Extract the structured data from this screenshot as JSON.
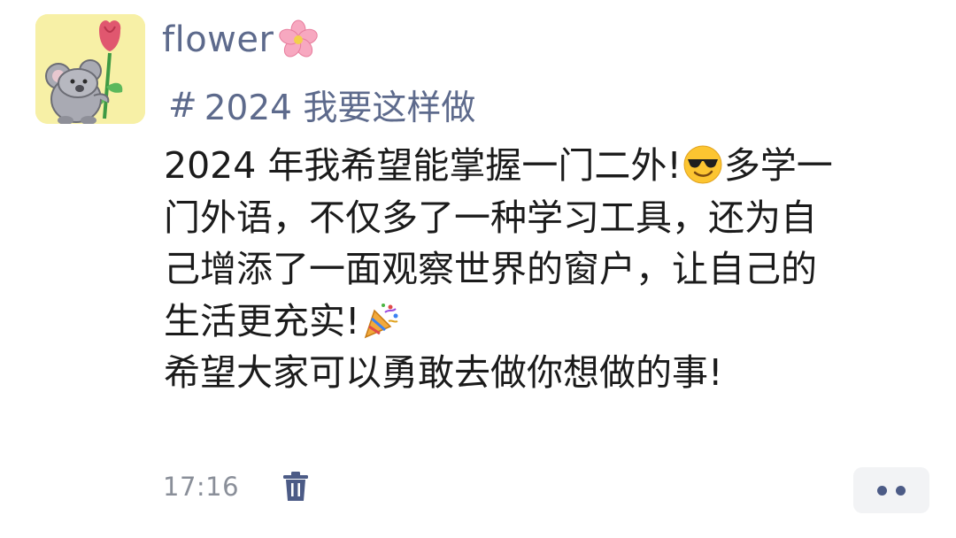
{
  "post": {
    "author": {
      "name": "flower",
      "name_emoji_icon": "cherry-blossom-icon",
      "avatar_icon": "koala-holding-rose-avatar"
    },
    "topic": {
      "hash": "#",
      "label": "2024 我要这样做"
    },
    "content_lines": [
      {
        "text_before": "2024 年我希望能掌握一门二外!",
        "emoji_icon": "sunglasses-face-icon",
        "text_after": "多学一"
      },
      {
        "text": "门外语，不仅多了一种学习工具，还为自"
      },
      {
        "text": "己增添了一面观察世界的窗户，让自己的"
      },
      {
        "text_before": "生活更充实!",
        "emoji_icon": "party-popper-icon",
        "text_after": ""
      },
      {
        "text": "希望大家可以勇敢去做你想做的事!"
      }
    ],
    "timestamp": "17:16",
    "delete_icon": "trash-icon",
    "more_icon": "more-dots-icon"
  },
  "colors": {
    "username": "#5d6a8c",
    "topic": "#5d6a8c",
    "body_text": "#1b1b1b",
    "timestamp": "#8a8f99",
    "icon_accent": "#4c5b86",
    "avatar_bg": "#f7f0a6",
    "more_button_bg": "#f2f3f5"
  }
}
